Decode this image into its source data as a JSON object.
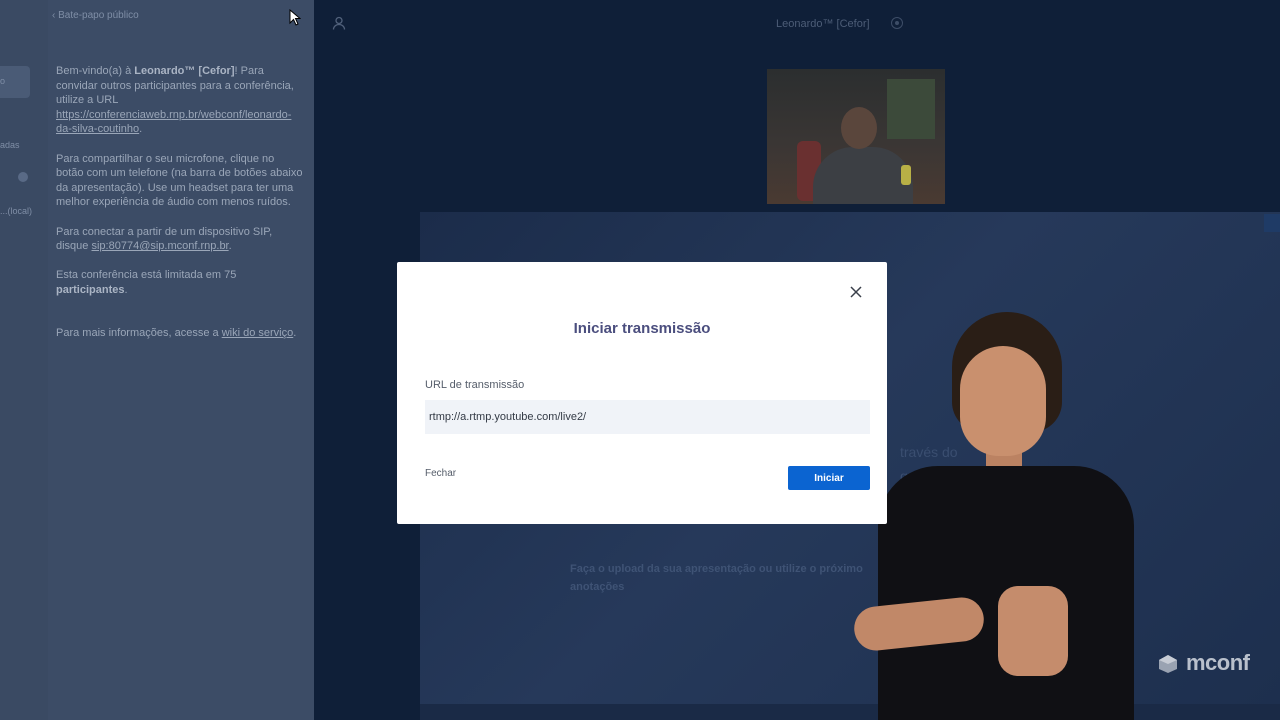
{
  "chat_panel": {
    "back_label": "Bate-papo público",
    "messages": [
      {
        "parts": [
          {
            "text": "Bem-vindo(a) à ",
            "style": "plain"
          },
          {
            "text": "Leonardo™ [Cefor]",
            "style": "bold"
          },
          {
            "text": "! Para convidar outros participantes para a conferência, utilize a URL ",
            "style": "plain"
          },
          {
            "text": "https://conferenciaweb.rnp.br/webconf/leonardo-da-silva-coutinho",
            "style": "link"
          },
          {
            "text": ".",
            "style": "plain"
          }
        ]
      },
      {
        "parts": [
          {
            "text": "Para compartilhar o seu microfone, clique no botão com um telefone (na barra de botões abaixo da apresentação). Use um headset para ter uma melhor experiência de áudio com menos ruídos.",
            "style": "plain"
          }
        ]
      },
      {
        "parts": [
          {
            "text": "Para conectar a partir de um dispositivo SIP, disque ",
            "style": "plain"
          },
          {
            "text": "sip:80774@sip.mconf.rnp.br",
            "style": "link"
          },
          {
            "text": ".",
            "style": "plain"
          }
        ]
      },
      {
        "parts": [
          {
            "text": "Esta conferência está limitada em 75 ",
            "style": "plain"
          },
          {
            "text": "participantes",
            "style": "bold"
          },
          {
            "text": ".",
            "style": "plain"
          }
        ]
      },
      {
        "parts": [
          {
            "text": "Para mais informações, acesse a ",
            "style": "plain"
          },
          {
            "text": "wiki do serviço",
            "style": "link"
          },
          {
            "text": ".",
            "style": "plain"
          }
        ]
      }
    ]
  },
  "left_rail": {
    "snippets": [
      "o",
      "adas",
      "...(local)"
    ]
  },
  "header": {
    "meeting_title": "Leonardo™ [Cefor]"
  },
  "presentation": {
    "hint": "Faça o upload da sua apresentação ou utilize o próximo",
    "hint_line2": "anotações",
    "faint_line1": "través do",
    "faint_line2": "gerar um"
  },
  "modal": {
    "title": "Iniciar transmissão",
    "field_label": "URL de transmissão",
    "field_value": "rtmp://a.rtmp.youtube.com/live2/",
    "cancel_label": "Fechar",
    "start_label": "Iniciar"
  },
  "watermark": {
    "brand": "mconf"
  },
  "colors": {
    "accent": "#0b64d1",
    "modal_title": "#4b4e7e",
    "background": "#0f1f38"
  }
}
